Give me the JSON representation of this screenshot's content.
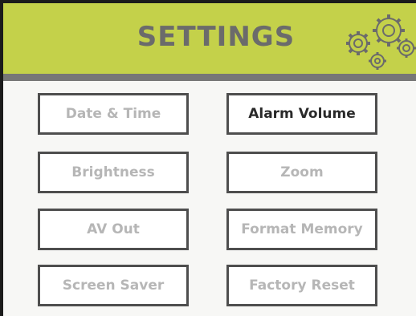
{
  "header": {
    "title": "SETTINGS",
    "icon": "gears-icon"
  },
  "colors": {
    "header_bg": "#c4d14a",
    "divider": "#777777",
    "title": "#6b6b6b",
    "button_border": "#4e4e4e",
    "button_text_inactive": "#b6b6b6",
    "button_text_active": "#2a2a2a"
  },
  "menu": {
    "items": [
      {
        "label": "Date & Time",
        "active": false
      },
      {
        "label": "Alarm Volume",
        "active": true
      },
      {
        "label": "Brightness",
        "active": false
      },
      {
        "label": "Zoom",
        "active": false
      },
      {
        "label": "AV Out",
        "active": false
      },
      {
        "label": "Format Memory",
        "active": false
      },
      {
        "label": "Screen Saver",
        "active": false
      },
      {
        "label": "Factory Reset",
        "active": false
      }
    ]
  }
}
